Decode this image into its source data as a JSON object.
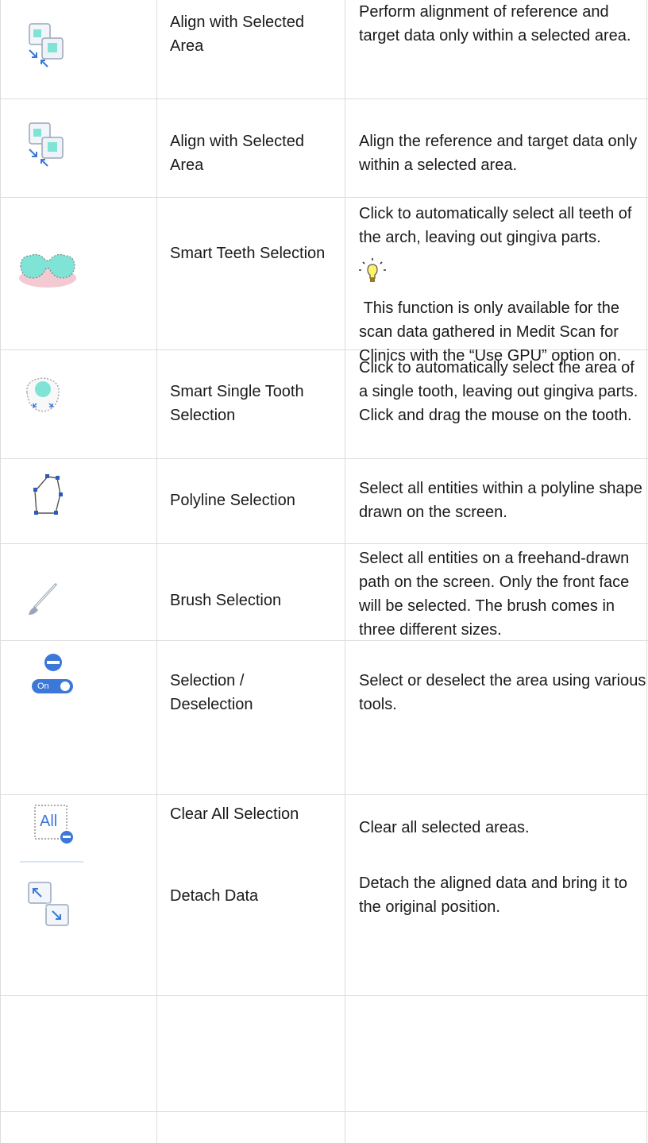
{
  "rows": [
    {
      "icon": "align-selected-area-icon",
      "name": "Align with Selected Area",
      "description": "Perform alignment of reference and target data only within a selected area."
    },
    {
      "icon": "align-selected-area-icon",
      "name": "Align with Selected Area",
      "description": "Align the reference and target data only within a selected area."
    },
    {
      "icon": "smart-teeth-selection-icon",
      "name": "Smart Teeth Selection",
      "description": "Click to automatically select all teeth of the arch, leaving out gingiva parts.",
      "tip_icon": "lightbulb-icon",
      "note": " This function is only available for the scan data gathered in Medit Scan for Clinics with the “Use GPU” option on."
    },
    {
      "icon": "smart-single-tooth-selection-icon",
      "name": "Smart Single Tooth Selection",
      "description": "Click to automatically select the area of a single tooth, leaving out gingiva parts. Click and drag the mouse on the tooth."
    },
    {
      "icon": "polyline-selection-icon",
      "name": "Polyline Selection",
      "description": "Select all entities within a polyline shape drawn on the screen."
    },
    {
      "icon": "brush-icon",
      "name": "Brush Selection",
      "description": "Select all entities on a freehand-drawn path on the screen. Only the front face will be selected. The brush comes in three different sizes."
    },
    {
      "icon": "selection-deselection-toggle-icon",
      "toggle_label": "On",
      "name": "Selection / Deselection",
      "description": "Select or deselect the area using various tools."
    },
    {
      "icon": "clear-all-selection-icon",
      "icon_label": "All",
      "name": "Clear All Selection",
      "description": "Clear all selected areas."
    },
    {
      "icon": "detach-data-icon",
      "name": "Detach Data",
      "description": "Detach the aligned data and bring it to the original position."
    }
  ]
}
